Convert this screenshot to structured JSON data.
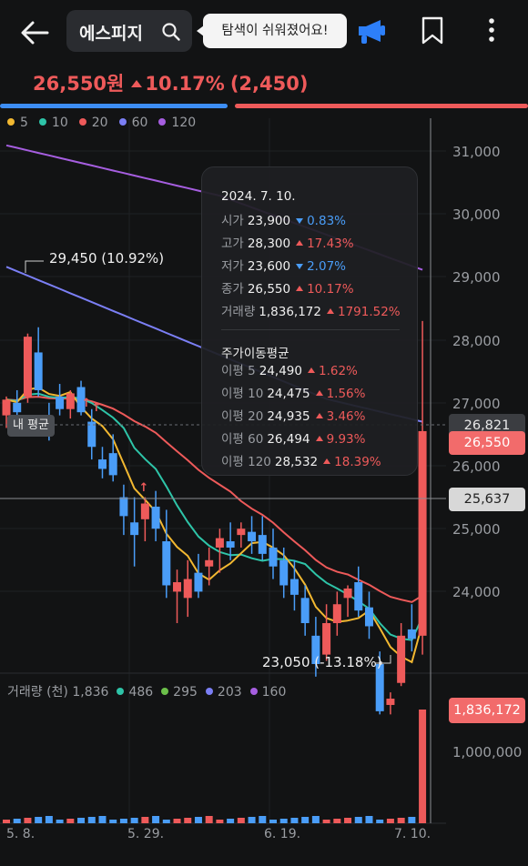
{
  "header": {
    "stock_name": "에스피지",
    "tooltip": "탐색이 쉬워졌어요!"
  },
  "price": {
    "current": "26,550원",
    "change_pct": "10.17%",
    "change_abs": "(2,450)"
  },
  "colors": {
    "up": "#ee5a5a",
    "down": "#4a9df8",
    "ma5": "#f2b831",
    "ma10": "#2ec4a8",
    "ma20": "#ee5a5a",
    "ma60": "#7b7ff5",
    "ma120": "#a65ee0"
  },
  "ma_legend": [
    {
      "label": "5",
      "color": "#f2b831"
    },
    {
      "label": "10",
      "color": "#2ec4a8"
    },
    {
      "label": "20",
      "color": "#ee5a5a"
    },
    {
      "label": "60",
      "color": "#7b7ff5"
    },
    {
      "label": "120",
      "color": "#a65ee0"
    }
  ],
  "price_axis": [
    "31,000",
    "30,000",
    "29,000",
    "28,000",
    "27,000",
    "26,000",
    "25,000",
    "24,000"
  ],
  "price_tags": {
    "avg": "26,821",
    "current": "26,550",
    "crosshair": "25,637"
  },
  "my_average_label": "내 평균",
  "annotations": {
    "high": "29,450 (10.92%)",
    "low": "23,050 (-13.18%)"
  },
  "popup": {
    "date": "2024. 7. 10.",
    "ohlc": [
      {
        "key": "시가",
        "value": "23,900",
        "dir": "down",
        "pct": "0.83%"
      },
      {
        "key": "고가",
        "value": "28,300",
        "dir": "up",
        "pct": "17.43%"
      },
      {
        "key": "저가",
        "value": "23,600",
        "dir": "down",
        "pct": "2.07%"
      },
      {
        "key": "종가",
        "value": "26,550",
        "dir": "up",
        "pct": "10.17%"
      },
      {
        "key": "거래량",
        "value": "1,836,172",
        "dir": "up",
        "pct": "1791.52%"
      }
    ],
    "ma_title": "주가이동평균",
    "ma": [
      {
        "key": "이평 5",
        "value": "24,490",
        "dir": "up",
        "pct": "1.62%"
      },
      {
        "key": "이평 10",
        "value": "24,475",
        "dir": "up",
        "pct": "1.56%"
      },
      {
        "key": "이평 20",
        "value": "24,935",
        "dir": "up",
        "pct": "3.46%"
      },
      {
        "key": "이평 60",
        "value": "26,494",
        "dir": "up",
        "pct": "9.93%"
      },
      {
        "key": "이평 120",
        "value": "28,532",
        "dir": "up",
        "pct": "18.39%"
      }
    ]
  },
  "volume": {
    "legend": [
      {
        "label": "거래량 (천) 1,836",
        "color": ""
      },
      {
        "label": "486",
        "color": "#2ec4a8"
      },
      {
        "label": "295",
        "color": "#6cc04a"
      },
      {
        "label": "203",
        "color": "#7b7ff5"
      },
      {
        "label": "160",
        "color": "#a65ee0"
      }
    ],
    "axis": "1,000,000",
    "tag": "1,836,172"
  },
  "dates": [
    "5. 8.",
    "5. 29.",
    "6. 19.",
    "7. 10."
  ],
  "chart_data": {
    "type": "candlestick",
    "y_range": [
      23000,
      31700
    ],
    "candles": [
      {
        "o": 26800,
        "h": 27100,
        "l": 26600,
        "c": 27050
      },
      {
        "o": 27000,
        "h": 27200,
        "l": 26700,
        "c": 26850
      },
      {
        "o": 27100,
        "h": 28100,
        "l": 27000,
        "c": 28050
      },
      {
        "o": 27800,
        "h": 28200,
        "l": 27100,
        "c": 27200
      },
      {
        "o": 26800,
        "h": 27000,
        "l": 26400,
        "c": 26550
      },
      {
        "o": 27100,
        "h": 27300,
        "l": 26800,
        "c": 26900
      },
      {
        "o": 26900,
        "h": 27200,
        "l": 26750,
        "c": 27150
      },
      {
        "o": 27250,
        "h": 27350,
        "l": 26800,
        "c": 26850
      },
      {
        "o": 26700,
        "h": 26900,
        "l": 26100,
        "c": 26300
      },
      {
        "o": 26100,
        "h": 26300,
        "l": 25800,
        "c": 25950
      },
      {
        "o": 26200,
        "h": 26500,
        "l": 25750,
        "c": 25850
      },
      {
        "o": 25500,
        "h": 25700,
        "l": 24900,
        "c": 25200
      },
      {
        "o": 25100,
        "h": 25500,
        "l": 24400,
        "c": 24900
      },
      {
        "o": 25150,
        "h": 25500,
        "l": 24800,
        "c": 25400
      },
      {
        "o": 25350,
        "h": 25600,
        "l": 24800,
        "c": 25000
      },
      {
        "o": 24800,
        "h": 25300,
        "l": 23900,
        "c": 24100
      },
      {
        "o": 24000,
        "h": 24350,
        "l": 23500,
        "c": 24150
      },
      {
        "o": 23900,
        "h": 24500,
        "l": 23600,
        "c": 24200
      },
      {
        "o": 24300,
        "h": 24600,
        "l": 23900,
        "c": 24000
      },
      {
        "o": 24400,
        "h": 24700,
        "l": 24100,
        "c": 24500
      },
      {
        "o": 24700,
        "h": 25000,
        "l": 24300,
        "c": 24850
      },
      {
        "o": 24800,
        "h": 25100,
        "l": 24500,
        "c": 24700
      },
      {
        "o": 24900,
        "h": 25100,
        "l": 24700,
        "c": 25000
      },
      {
        "o": 24950,
        "h": 25200,
        "l": 24600,
        "c": 24800
      },
      {
        "o": 24900,
        "h": 25200,
        "l": 24500,
        "c": 24600
      },
      {
        "o": 24700,
        "h": 25000,
        "l": 24200,
        "c": 24400
      },
      {
        "o": 24500,
        "h": 24700,
        "l": 23900,
        "c": 24100
      },
      {
        "o": 24200,
        "h": 24500,
        "l": 23700,
        "c": 23950
      },
      {
        "o": 23900,
        "h": 24100,
        "l": 23300,
        "c": 23500
      },
      {
        "o": 23300,
        "h": 23600,
        "l": 22650,
        "c": 22850
      },
      {
        "o": 23000,
        "h": 23800,
        "l": 22900,
        "c": 23500
      },
      {
        "o": 23500,
        "h": 24000,
        "l": 23300,
        "c": 23800
      },
      {
        "o": 23900,
        "h": 24100,
        "l": 23600,
        "c": 24050
      },
      {
        "o": 24150,
        "h": 24400,
        "l": 23600,
        "c": 23700
      },
      {
        "o": 23750,
        "h": 24000,
        "l": 23250,
        "c": 23450
      },
      {
        "o": 22850,
        "h": 23050,
        "l": 22050,
        "c": 22100
      },
      {
        "o": 22200,
        "h": 22400,
        "l": 22050,
        "c": 22300
      },
      {
        "o": 22550,
        "h": 23500,
        "l": 22500,
        "c": 23300
      },
      {
        "o": 23400,
        "h": 23800,
        "l": 23050,
        "c": 23250
      },
      {
        "o": 23300,
        "h": 28300,
        "l": 23000,
        "c": 26550
      }
    ]
  }
}
